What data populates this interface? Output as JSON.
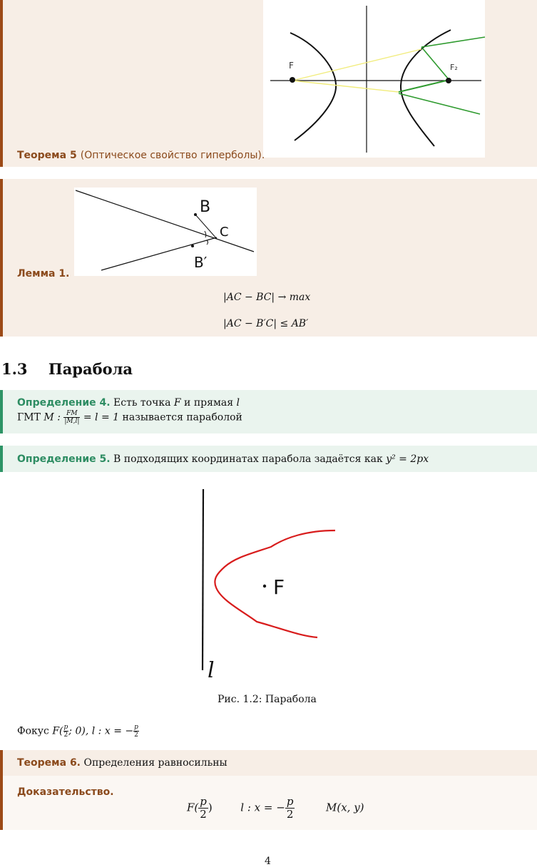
{
  "theorem5": {
    "label": "Теорема 5",
    "note": "(Оптическое свойство гиперболы)."
  },
  "lemma1": {
    "label": "Лемма 1.",
    "eq1": "|AC − BC| → max",
    "eq2": "|AC − B′C| ≤ AB′",
    "fig_labels": {
      "B": "B",
      "C": "C",
      "Bp": "B′"
    }
  },
  "section": {
    "number": "1.3",
    "title": "Парабола"
  },
  "def4": {
    "label": "Определение 4.",
    "line1_pre": "Есть точка",
    "F": "F",
    "line1_mid": "и прямая",
    "l": "l",
    "line2_pre": "ГМТ",
    "M": "M :",
    "frac_num": "FM",
    "frac_den": "|M,l|",
    "line2_eq": "= l = 1",
    "line2_post": "называется параболой"
  },
  "def5": {
    "label": "Определение 5.",
    "text": "В подходящих координатах парабола задаётся как",
    "formula": "y² = 2px"
  },
  "figure": {
    "caption": "Рис. 1.2: Парабола",
    "label_F": "F",
    "label_l": "l"
  },
  "focus": {
    "pre": "Фокус",
    "F": "F(",
    "num": "p",
    "den": "2",
    "mid": "; 0),",
    "l": "l : x = −",
    "num2": "p",
    "den2": "2"
  },
  "theorem6": {
    "label": "Теорема 6.",
    "text": "Определения равносильны"
  },
  "proof": {
    "label": "Доказательство.",
    "F_pre": "F(",
    "F_num": "p",
    "F_den": "2",
    "F_post": ")",
    "l_pre": "l : x = −",
    "l_num": "p",
    "l_den": "2",
    "M": "M(x, y)"
  },
  "page_number": "4"
}
